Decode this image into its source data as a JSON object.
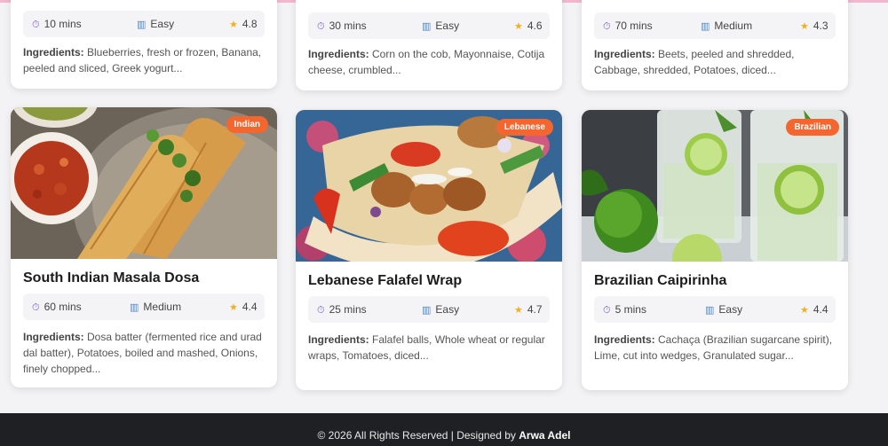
{
  "footer": {
    "text": "© 2026 All Rights Reserved | Designed by ",
    "author": "Arwa Adel"
  },
  "ingredients_label": "Ingredients:",
  "top_cards": [
    {
      "time": "10 mins",
      "difficulty": "Easy",
      "rating": "4.8",
      "ingredients": "Blueberries, fresh or frozen, Banana, peeled and sliced, Greek yogurt..."
    },
    {
      "time": "30 mins",
      "difficulty": "Easy",
      "rating": "4.6",
      "ingredients": "Corn on the cob, Mayonnaise, Cotija cheese, crumbled..."
    },
    {
      "time": "70 mins",
      "difficulty": "Medium",
      "rating": "4.3",
      "ingredients": "Beets, peeled and shredded, Cabbage, shredded, Potatoes, diced..."
    }
  ],
  "bottom_cards": [
    {
      "badge": "Indian",
      "title": "South Indian Masala Dosa",
      "time": "60 mins",
      "difficulty": "Medium",
      "rating": "4.4",
      "ingredients": "Dosa batter (fermented rice and urad dal batter), Potatoes, boiled and mashed, Onions, finely chopped..."
    },
    {
      "badge": "Lebanese",
      "title": "Lebanese Falafel Wrap",
      "time": "25 mins",
      "difficulty": "Easy",
      "rating": "4.7",
      "ingredients": "Falafel balls, Whole wheat or regular wraps, Tomatoes, diced..."
    },
    {
      "badge": "Brazilian",
      "title": "Brazilian Caipirinha",
      "time": "5 mins",
      "difficulty": "Easy",
      "rating": "4.4",
      "ingredients": "Cachaça (Brazilian sugarcane spirit), Lime, cut into wedges, Granulated sugar..."
    }
  ],
  "colors": {
    "badge": "#f4662f",
    "footer_bg": "#1f2023",
    "page_bg": "#f3f2f4",
    "star": "#f2b01e"
  },
  "icons": {
    "time": "timer-icon",
    "difficulty": "bar-chart-icon",
    "rating": "star-icon"
  }
}
